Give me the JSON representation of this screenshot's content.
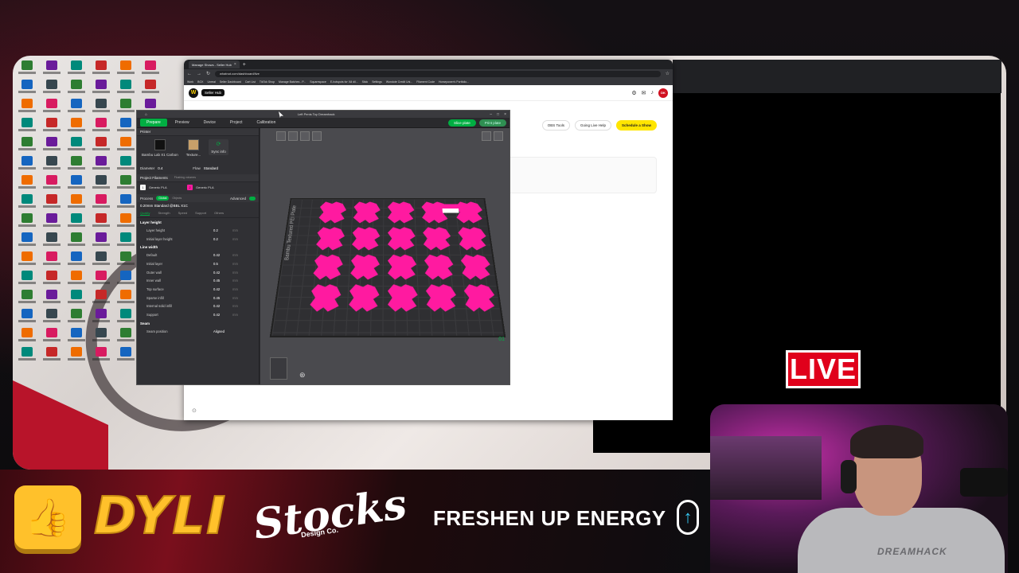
{
  "browser": {
    "tab_title": "Manage Shows - Seller Hub",
    "url": "whatnot.com/dashboard/live",
    "bookmarks": [
      "Work",
      "BOX",
      "Unreal",
      "Seller Dashboard",
      "Cart List",
      "TikTok Shop",
      "Manage Batches - P...",
      "Squarespace",
      "E-hotspots for 'All dil...",
      "Stick",
      "Settings",
      "Wondote Credit Uni...",
      "Filament Code",
      "Horsepower's Portfolio..."
    ],
    "seller_hub_label": "Seller Hub",
    "avatar_text": "DK",
    "actions": [
      "OBS Tools",
      "Going Live Help",
      "Schedule a Show"
    ]
  },
  "bambu": {
    "window_title": "Left Penis Toy Dreamhack",
    "tabs": [
      "Prepare",
      "Preview",
      "Device",
      "Project",
      "Calibration"
    ],
    "slice_buttons": [
      "Slice plate",
      "Print plate"
    ],
    "printer_section": "Printer",
    "printer_name": "Bambu Lab X1 Carbon",
    "plate_type": "Texture...",
    "sync_label": "Sync info",
    "diameter_label": "Diameter",
    "diameter_value": "0.4",
    "flow_label": "Flow",
    "flow_value": "Standard",
    "filaments_section": "Project Filaments",
    "flushing_label": "Flushing volumes",
    "filaments": [
      {
        "index": "1",
        "name": "Generic PLA",
        "color": "#ffffff"
      },
      {
        "index": "2",
        "name": "Generic PLA",
        "color": "#ff1aa0"
      }
    ],
    "process_label": "Process",
    "global_pill": "Global",
    "objects_label": "Objects",
    "advanced_label": "Advanced",
    "profile": "0.20mm Standard @BBL X1C",
    "subtabs": [
      "Quality",
      "Strength",
      "Speed",
      "Support",
      "Others"
    ],
    "groups": [
      {
        "title": "Layer height",
        "params": [
          {
            "name": "Layer height",
            "value": "0.2",
            "unit": "mm"
          },
          {
            "name": "Initial layer height",
            "value": "0.2",
            "unit": "mm"
          }
        ]
      },
      {
        "title": "Line width",
        "params": [
          {
            "name": "Default",
            "value": "0.42",
            "unit": "mm"
          },
          {
            "name": "Initial layer",
            "value": "0.5",
            "unit": "mm"
          },
          {
            "name": "Outer wall",
            "value": "0.42",
            "unit": "mm"
          },
          {
            "name": "Inner wall",
            "value": "0.45",
            "unit": "mm"
          },
          {
            "name": "Top surface",
            "value": "0.42",
            "unit": "mm"
          },
          {
            "name": "Sparse infill",
            "value": "0.45",
            "unit": "mm"
          },
          {
            "name": "Internal solid infill",
            "value": "0.42",
            "unit": "mm"
          },
          {
            "name": "Support",
            "value": "0.42",
            "unit": "mm"
          }
        ]
      },
      {
        "title": "Seam",
        "params": [
          {
            "name": "Seam position",
            "value": "Aligned",
            "unit": ""
          }
        ]
      }
    ],
    "plate_label": "Bambu Textured PEI Plate",
    "plate_number": "01",
    "part_count": 20
  },
  "overlay": {
    "live": "LIVE",
    "sponsors": {
      "dyli": "DYLI",
      "stocks": "Stocks",
      "stocks_sub": "Design Co.",
      "freshen": "FRESHEN UP ENERGY"
    },
    "shirt_brand": "DREAMHACK"
  },
  "colors": {
    "bambu_green": "#00ae42",
    "part_pink": "#ff1aa0",
    "live_red": "#e0001b",
    "dyli_yellow": "#ffc12b",
    "whatnot_yellow": "#ffe500"
  }
}
